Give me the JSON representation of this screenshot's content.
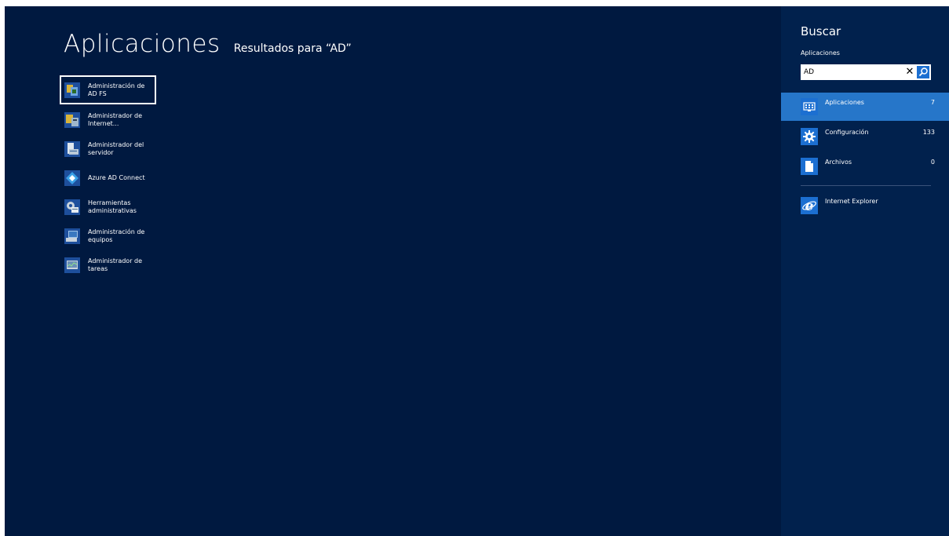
{
  "header": {
    "title": "Aplicaciones",
    "subtitle": "Resultados para “AD”"
  },
  "results": [
    {
      "label": "Administración de AD FS",
      "icon": "ad-fs-management-icon",
      "selected": true
    },
    {
      "label": "Administrador de Internet...",
      "icon": "iis-manager-icon",
      "selected": false
    },
    {
      "label": "Administrador del servidor",
      "icon": "server-manager-icon",
      "selected": false
    },
    {
      "label": "Azure AD Connect",
      "icon": "azure-ad-connect-icon",
      "selected": false
    },
    {
      "label": "Herramientas administrativas",
      "icon": "admin-tools-icon",
      "selected": false
    },
    {
      "label": "Administración de equipos",
      "icon": "computer-management-icon",
      "selected": false
    },
    {
      "label": "Administrador de tareas",
      "icon": "task-manager-icon",
      "selected": false
    }
  ],
  "search_pane": {
    "title": "Buscar",
    "scope_label": "Aplicaciones",
    "query": "AD",
    "clear_glyph": "✕",
    "scopes": [
      {
        "label": "Aplicaciones",
        "count": "7",
        "icon": "apps-icon",
        "active": true
      },
      {
        "label": "Configuración",
        "count": "133",
        "icon": "settings-gear-icon",
        "active": false
      },
      {
        "label": "Archivos",
        "count": "0",
        "icon": "file-icon",
        "active": false
      }
    ],
    "suggested_apps": [
      {
        "label": "Internet Explorer",
        "icon": "internet-explorer-icon"
      }
    ]
  },
  "colors": {
    "background": "#001940",
    "pane_background": "#01214d",
    "active_scope": "#2676c9",
    "search_button": "#1c6fd1"
  }
}
